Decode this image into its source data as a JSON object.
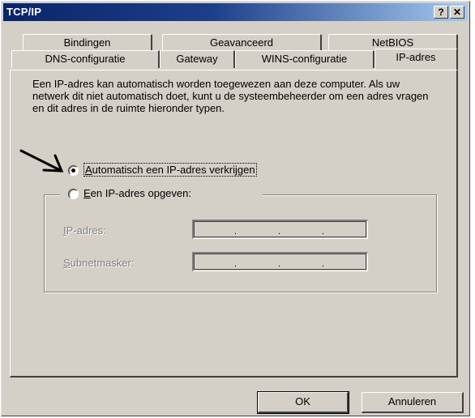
{
  "window": {
    "title": "TCP/IP",
    "help_label": "?",
    "close_label": "✕"
  },
  "tabs": {
    "row_back": [
      "Bindingen",
      "Geavanceerd",
      "NetBIOS"
    ],
    "row_front": [
      "DNS-configuratie",
      "Gateway",
      "WINS-configuratie",
      "IP-adres"
    ],
    "active": "IP-adres"
  },
  "panel": {
    "description": "Een IP-adres kan automatisch worden toegewezen aan deze computer. Als uw netwerk dit niet automatisch doet, kunt u de systeembeheerder om een adres vragen en dit adres in de ruimte hieronder typen.",
    "radio_auto": {
      "hotkey": "A",
      "rest": "utomatisch een IP-adres verkrijgen",
      "checked": true
    },
    "radio_manual": {
      "hotkey": "E",
      "rest": "en IP-adres opgeven:",
      "checked": false
    },
    "ip_label": {
      "hotkey": "I",
      "rest": "P-adres:"
    },
    "subnet_label": {
      "hotkey": "S",
      "rest": "ubnetmasker:"
    },
    "ip_separator": "."
  },
  "buttons": {
    "ok": "OK",
    "cancel": "Annuleren"
  },
  "annotation": {
    "arrow_icon": "arrow-pointer-icon"
  },
  "colors": {
    "face": "#d4d0c8",
    "title_start": "#0a246a",
    "title_end": "#a6caf0",
    "disabled_text": "#808080"
  }
}
